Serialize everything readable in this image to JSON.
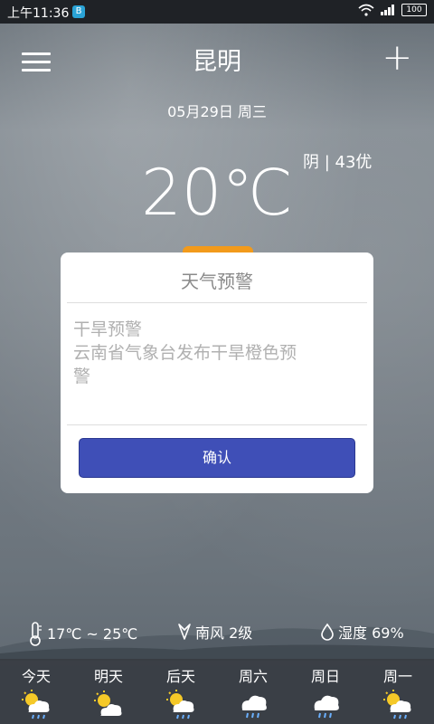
{
  "status": {
    "time": "上午11:36",
    "app_badge": "B",
    "battery": "100"
  },
  "header": {
    "city": "昆明",
    "date": "05月29日 周三"
  },
  "current": {
    "temperature": "20℃",
    "condition": "阴 | 43优"
  },
  "dialog": {
    "title": "天气预警",
    "body_line1": "干旱预警",
    "body_line2": "云南省气象台发布干旱橙色预",
    "body_line3": "警",
    "confirm_label": "确认"
  },
  "stats": {
    "temp_range": "17℃ ~ 25℃",
    "wind": "南风 2级",
    "humidity": "湿度 69%"
  },
  "forecast": [
    {
      "label": "今天",
      "icon": "partly-cloudy-rain-icon"
    },
    {
      "label": "明天",
      "icon": "partly-cloudy-icon"
    },
    {
      "label": "后天",
      "icon": "partly-cloudy-rain-icon"
    },
    {
      "label": "周六",
      "icon": "cloud-rain-icon"
    },
    {
      "label": "周日",
      "icon": "cloud-rain-icon"
    },
    {
      "label": "周一",
      "icon": "partly-cloudy-rain-icon"
    }
  ],
  "colors": {
    "accent": "#3f4fb7",
    "tab": "#f29a1b"
  }
}
